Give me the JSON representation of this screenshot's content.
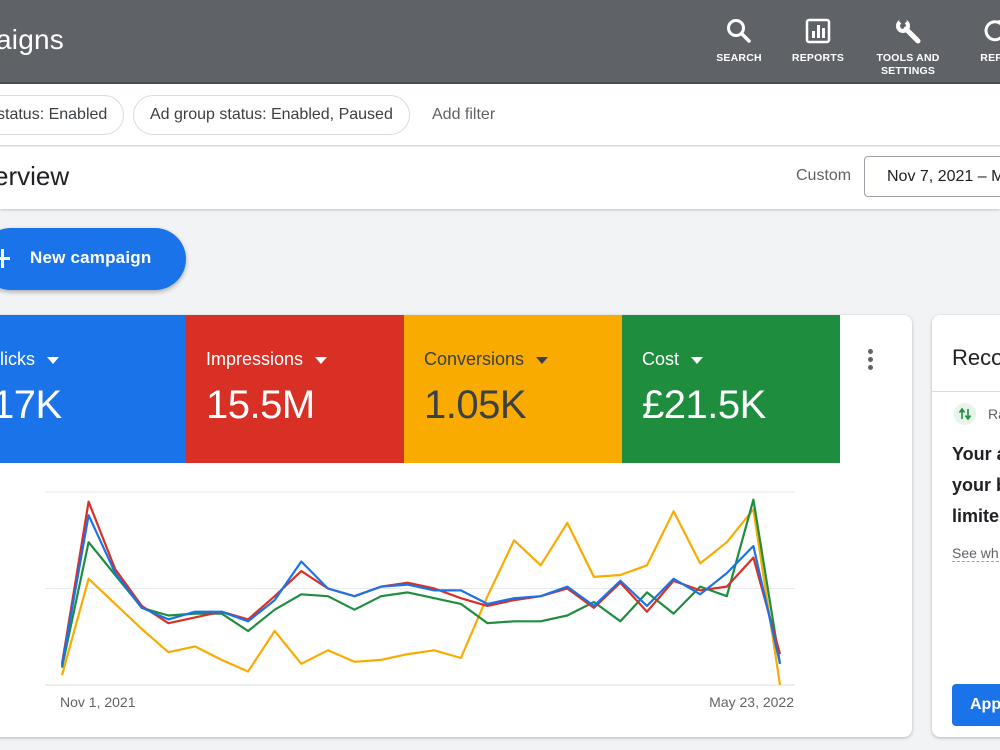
{
  "header": {
    "app_title": "aigns",
    "actions": [
      {
        "label": "SEARCH",
        "icon": "search-icon"
      },
      {
        "label": "REPORTS",
        "icon": "reports-icon"
      },
      {
        "label": "TOOLS AND\nSETTINGS",
        "icon": "wrench-icon"
      },
      {
        "label": "REFR",
        "icon": "refresh-icon"
      }
    ],
    "background": "#5f6368"
  },
  "filters": {
    "chips": [
      "status: Enabled",
      "Ad group status: Enabled, Paused"
    ],
    "add_filter": "Add filter"
  },
  "overview": {
    "title": "erview",
    "range_label": "Custom",
    "date_range": "Nov 7, 2021 – M"
  },
  "new_campaign": {
    "label": "New campaign"
  },
  "metrics": [
    {
      "name": "licks",
      "value": "17K",
      "color": "#1a73e8"
    },
    {
      "name": "Impressions",
      "value": "15.5M",
      "color": "#d93025"
    },
    {
      "name": "Conversions",
      "value": "1.05K",
      "color": "#f9ab00"
    },
    {
      "name": "Cost",
      "value": "£21.5K",
      "color": "#1e8e3e"
    }
  ],
  "chart_data": {
    "type": "line",
    "x_start_label": "Nov 1, 2021",
    "x_end_label": "May 23, 2022",
    "grid": true,
    "ylim": [
      0,
      100
    ],
    "series": [
      {
        "color": "#1a73e8",
        "values": [
          10,
          88,
          58,
          40,
          34,
          38,
          38,
          33,
          44,
          64,
          50,
          46,
          51,
          52,
          49,
          49,
          42,
          45,
          46,
          51,
          41,
          54,
          41,
          55,
          47,
          58,
          72,
          11
        ]
      },
      {
        "color": "#d93025",
        "values": [
          11,
          95,
          60,
          41,
          32,
          35,
          38,
          34,
          46,
          59,
          50,
          46,
          51,
          53,
          50,
          45,
          41,
          44,
          46,
          50,
          40,
          53,
          38,
          54,
          49,
          51,
          66,
          16
        ]
      },
      {
        "color": "#1e8e3e",
        "values": [
          9,
          74,
          57,
          40,
          36,
          37,
          37,
          28,
          39,
          47,
          46,
          39,
          46,
          48,
          45,
          42,
          32,
          33,
          33,
          36,
          43,
          33,
          48,
          37,
          51,
          46,
          96,
          11
        ]
      },
      {
        "color": "#f9ab00",
        "values": [
          5,
          55,
          42,
          29,
          17,
          20,
          13,
          7,
          28,
          11,
          18,
          12,
          13,
          16,
          18,
          14,
          46,
          75,
          62,
          84,
          56,
          57,
          62,
          90,
          63,
          74,
          91,
          0
        ]
      }
    ]
  },
  "recommendation": {
    "title": "Reco",
    "type": "Ra",
    "body": [
      "Your a",
      "your b",
      "limite"
    ],
    "link": "See wh",
    "apply": "App"
  }
}
